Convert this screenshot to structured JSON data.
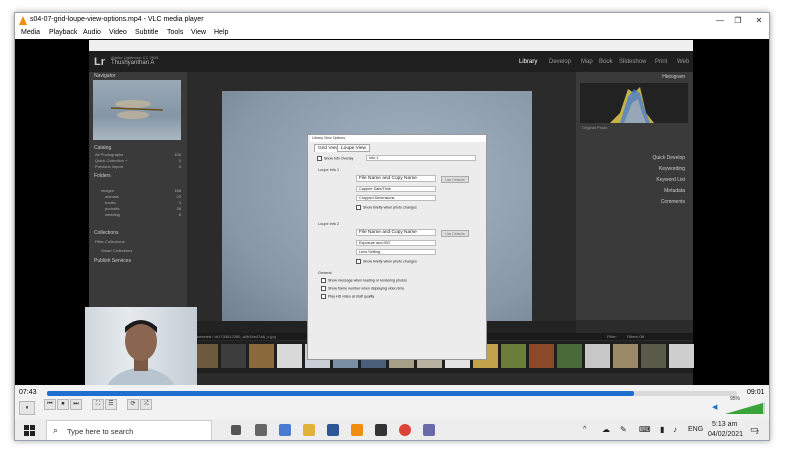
{
  "window": {
    "title": "s04-07-grid-loupe-view-options.mp4 - VLC media player",
    "minimize": "—",
    "restore": "❐",
    "close": "✕"
  },
  "menu": [
    "Media",
    "Playback",
    "Audio",
    "Video",
    "Subtitle",
    "Tools",
    "View",
    "Help"
  ],
  "lightroom": {
    "logo": "Lr",
    "catalog": "Adobe Lightroom CC 2015",
    "user": "Thushyanthan A",
    "modules": [
      "Library",
      "Develop",
      "Map",
      "Book",
      "Slideshow",
      "Print",
      "Web"
    ],
    "active_module": "Library",
    "left": {
      "navigator": "Navigator",
      "catalog": "Catalog",
      "catalog_items": [
        {
          "label": "All Photographs",
          "count": "106"
        },
        {
          "label": "Quick Collection +",
          "count": "0"
        },
        {
          "label": "Previous Import",
          "count": "0"
        }
      ],
      "folders": "Folders",
      "folder_rows": [
        {
          "label": "images",
          "count": "168"
        },
        {
          "label": "animals",
          "count": "23"
        },
        {
          "label": "books",
          "count": "3"
        },
        {
          "label": "portraits",
          "count": "28"
        },
        {
          "label": "wedding",
          "count": "8"
        }
      ],
      "collections": "Collections",
      "collection_rows": [
        "Filter Collections",
        "Smart Collections"
      ],
      "publish": "Publish Services"
    },
    "right": {
      "histogram": "Histogram",
      "original": "Original Photo",
      "panels": [
        "Quick Develop",
        "Keywording",
        "Keyword List",
        "Metadata",
        "Comments"
      ]
    },
    "filmstrip_info": "1 selected / dr1700612280_a0b34e47a8_o.jpg",
    "filter_label": "Filter:",
    "filter_value": "Filters Off"
  },
  "dialog": {
    "title": "Library View Options",
    "tabs": [
      "Grid View",
      "Loupe View"
    ],
    "show_info_overlay": "Show Info Overlay",
    "overlay_value": "Info 1",
    "loupe_info_1": "Loupe Info 1",
    "loupe_info_2": "Loupe Info 2",
    "info1": [
      "File Name and Copy Name",
      "Capture Date/Time",
      "Cropped Dimensions"
    ],
    "info2": [
      "File Name and Copy Name",
      "Exposure and ISO",
      "Lens Setting"
    ],
    "use_defaults": "Use Defaults",
    "show_briefly": "Show briefly when photo changes",
    "general": "General",
    "general_opts": [
      "Show message when loading or rendering photos",
      "Show frame number when displaying video time",
      "Play HD video at draft quality"
    ]
  },
  "player": {
    "elapsed": "07:43",
    "total": "09:01",
    "progress_pct": 85,
    "volume": "95%",
    "buttons": [
      "⏸",
      "⏮",
      "⏹",
      "⏭",
      "⛶",
      "☰",
      "⟳",
      "⤮"
    ]
  },
  "taskbar": {
    "search_placeholder": "Type here to search",
    "lang": "ENG",
    "time": "5:13 am",
    "date": "04/02/2021",
    "notification_count": "2"
  }
}
